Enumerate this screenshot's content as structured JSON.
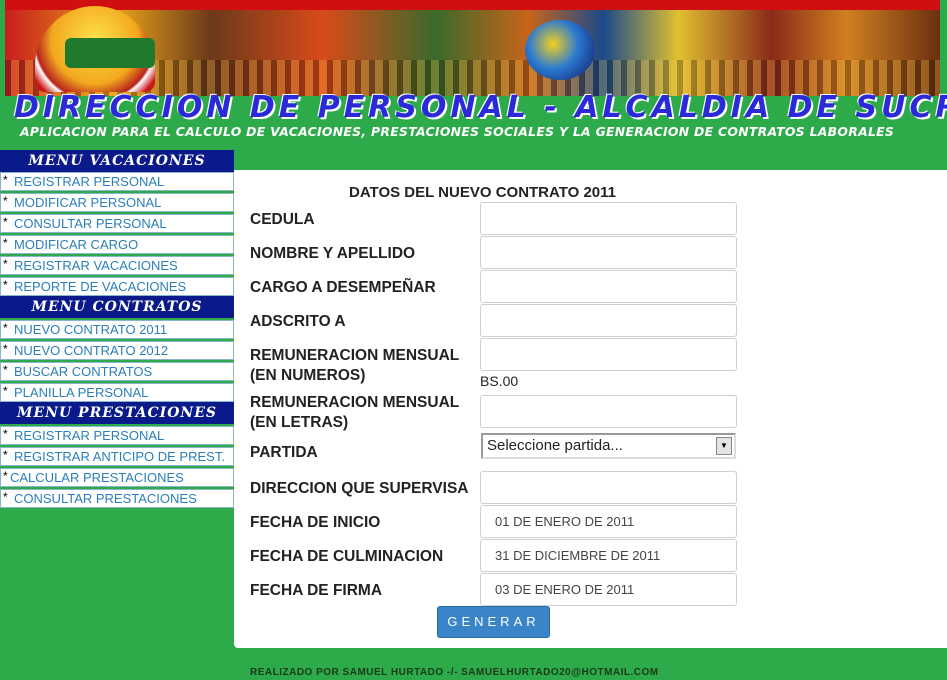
{
  "header": {
    "title": "DIRECCION DE PERSONAL - ALCALDIA DE SUCRE",
    "subtitle": "APLICACION PARA EL CALCULO DE VACACIONES, PRESTACIONES SOCIALES Y LA GENERACION DE CONTRATOS LABORALES"
  },
  "menu_vacaciones": {
    "title": "MENU VACACIONES",
    "items": [
      "REGISTRAR PERSONAL",
      "MODIFICAR PERSONAL",
      "CONSULTAR PERSONAL",
      "MODIFICAR CARGO",
      "REGISTRAR VACACIONES",
      "REPORTE DE VACACIONES"
    ]
  },
  "menu_contratos": {
    "title": "MENU CONTRATOS",
    "items": [
      "NUEVO CONTRATO 2011",
      "NUEVO CONTRATO 2012",
      "BUSCAR CONTRATOS",
      "PLANILLA PERSONAL"
    ]
  },
  "menu_prestaciones": {
    "title": "MENU PRESTACIONES",
    "items": [
      "REGISTRAR PERSONAL",
      "REGISTRAR ANTICIPO DE PREST.",
      "CALCULAR PRESTACIONES",
      "CONSULTAR PRESTACIONES"
    ]
  },
  "menu_bullet": "*",
  "form": {
    "title": "DATOS DEL NUEVO CONTRATO 2011",
    "labels": {
      "cedula": "CEDULA",
      "nombre": "NOMBRE Y APELLIDO",
      "cargo": "CARGO A DESEMPEÑAR",
      "adscrito": "ADSCRITO A",
      "rem_num": "REMUNERACION MENSUAL (EN NUMEROS)",
      "rem_let": "REMUNERACION MENSUAL (EN LETRAS)",
      "partida": "PARTIDA",
      "direccion": "DIRECCION QUE SUPERVISA",
      "fecha_inicio": "FECHA DE INICIO",
      "fecha_culminacion": "FECHA DE CULMINACION",
      "fecha_firma": "FECHA DE FIRMA"
    },
    "values": {
      "cedula": "",
      "nombre": "",
      "cargo": "",
      "adscrito": "",
      "rem_num": "",
      "rem_let": "",
      "partida_selected": "Seleccione partida...",
      "direccion": "",
      "fecha_inicio": "01 DE ENERO DE 2011",
      "fecha_culminacion": "31 DE DICIEMBRE DE 2011",
      "fecha_firma": "03 DE ENERO DE 2011"
    },
    "currency_suffix": "BS.00",
    "submit_label": "GENERAR"
  },
  "footer": "REALIZADO POR SAMUEL HURTADO -/- SAMUELHURTADO20@HOTMAIL.COM",
  "colors": {
    "background": "#2daa4a",
    "menu_header": "#0a1a8a",
    "menu_link": "#2a7fb8",
    "button": "#3a85c8",
    "title_blue": "#2a2ad8"
  }
}
